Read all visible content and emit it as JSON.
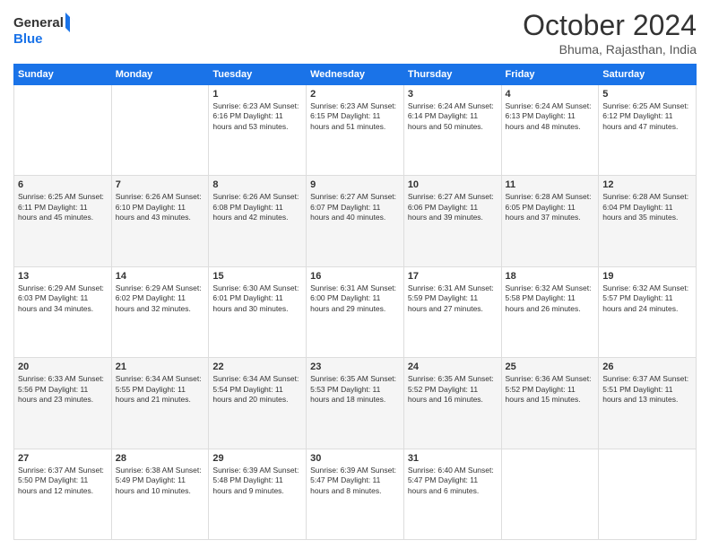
{
  "header": {
    "logo_line1": "General",
    "logo_line2": "Blue",
    "month": "October 2024",
    "location": "Bhuma, Rajasthan, India"
  },
  "days_of_week": [
    "Sunday",
    "Monday",
    "Tuesday",
    "Wednesday",
    "Thursday",
    "Friday",
    "Saturday"
  ],
  "weeks": [
    [
      {
        "day": "",
        "info": ""
      },
      {
        "day": "",
        "info": ""
      },
      {
        "day": "1",
        "info": "Sunrise: 6:23 AM\nSunset: 6:16 PM\nDaylight: 11 hours and 53 minutes."
      },
      {
        "day": "2",
        "info": "Sunrise: 6:23 AM\nSunset: 6:15 PM\nDaylight: 11 hours and 51 minutes."
      },
      {
        "day": "3",
        "info": "Sunrise: 6:24 AM\nSunset: 6:14 PM\nDaylight: 11 hours and 50 minutes."
      },
      {
        "day": "4",
        "info": "Sunrise: 6:24 AM\nSunset: 6:13 PM\nDaylight: 11 hours and 48 minutes."
      },
      {
        "day": "5",
        "info": "Sunrise: 6:25 AM\nSunset: 6:12 PM\nDaylight: 11 hours and 47 minutes."
      }
    ],
    [
      {
        "day": "6",
        "info": "Sunrise: 6:25 AM\nSunset: 6:11 PM\nDaylight: 11 hours and 45 minutes."
      },
      {
        "day": "7",
        "info": "Sunrise: 6:26 AM\nSunset: 6:10 PM\nDaylight: 11 hours and 43 minutes."
      },
      {
        "day": "8",
        "info": "Sunrise: 6:26 AM\nSunset: 6:08 PM\nDaylight: 11 hours and 42 minutes."
      },
      {
        "day": "9",
        "info": "Sunrise: 6:27 AM\nSunset: 6:07 PM\nDaylight: 11 hours and 40 minutes."
      },
      {
        "day": "10",
        "info": "Sunrise: 6:27 AM\nSunset: 6:06 PM\nDaylight: 11 hours and 39 minutes."
      },
      {
        "day": "11",
        "info": "Sunrise: 6:28 AM\nSunset: 6:05 PM\nDaylight: 11 hours and 37 minutes."
      },
      {
        "day": "12",
        "info": "Sunrise: 6:28 AM\nSunset: 6:04 PM\nDaylight: 11 hours and 35 minutes."
      }
    ],
    [
      {
        "day": "13",
        "info": "Sunrise: 6:29 AM\nSunset: 6:03 PM\nDaylight: 11 hours and 34 minutes."
      },
      {
        "day": "14",
        "info": "Sunrise: 6:29 AM\nSunset: 6:02 PM\nDaylight: 11 hours and 32 minutes."
      },
      {
        "day": "15",
        "info": "Sunrise: 6:30 AM\nSunset: 6:01 PM\nDaylight: 11 hours and 30 minutes."
      },
      {
        "day": "16",
        "info": "Sunrise: 6:31 AM\nSunset: 6:00 PM\nDaylight: 11 hours and 29 minutes."
      },
      {
        "day": "17",
        "info": "Sunrise: 6:31 AM\nSunset: 5:59 PM\nDaylight: 11 hours and 27 minutes."
      },
      {
        "day": "18",
        "info": "Sunrise: 6:32 AM\nSunset: 5:58 PM\nDaylight: 11 hours and 26 minutes."
      },
      {
        "day": "19",
        "info": "Sunrise: 6:32 AM\nSunset: 5:57 PM\nDaylight: 11 hours and 24 minutes."
      }
    ],
    [
      {
        "day": "20",
        "info": "Sunrise: 6:33 AM\nSunset: 5:56 PM\nDaylight: 11 hours and 23 minutes."
      },
      {
        "day": "21",
        "info": "Sunrise: 6:34 AM\nSunset: 5:55 PM\nDaylight: 11 hours and 21 minutes."
      },
      {
        "day": "22",
        "info": "Sunrise: 6:34 AM\nSunset: 5:54 PM\nDaylight: 11 hours and 20 minutes."
      },
      {
        "day": "23",
        "info": "Sunrise: 6:35 AM\nSunset: 5:53 PM\nDaylight: 11 hours and 18 minutes."
      },
      {
        "day": "24",
        "info": "Sunrise: 6:35 AM\nSunset: 5:52 PM\nDaylight: 11 hours and 16 minutes."
      },
      {
        "day": "25",
        "info": "Sunrise: 6:36 AM\nSunset: 5:52 PM\nDaylight: 11 hours and 15 minutes."
      },
      {
        "day": "26",
        "info": "Sunrise: 6:37 AM\nSunset: 5:51 PM\nDaylight: 11 hours and 13 minutes."
      }
    ],
    [
      {
        "day": "27",
        "info": "Sunrise: 6:37 AM\nSunset: 5:50 PM\nDaylight: 11 hours and 12 minutes."
      },
      {
        "day": "28",
        "info": "Sunrise: 6:38 AM\nSunset: 5:49 PM\nDaylight: 11 hours and 10 minutes."
      },
      {
        "day": "29",
        "info": "Sunrise: 6:39 AM\nSunset: 5:48 PM\nDaylight: 11 hours and 9 minutes."
      },
      {
        "day": "30",
        "info": "Sunrise: 6:39 AM\nSunset: 5:47 PM\nDaylight: 11 hours and 8 minutes."
      },
      {
        "day": "31",
        "info": "Sunrise: 6:40 AM\nSunset: 5:47 PM\nDaylight: 11 hours and 6 minutes."
      },
      {
        "day": "",
        "info": ""
      },
      {
        "day": "",
        "info": ""
      }
    ]
  ]
}
